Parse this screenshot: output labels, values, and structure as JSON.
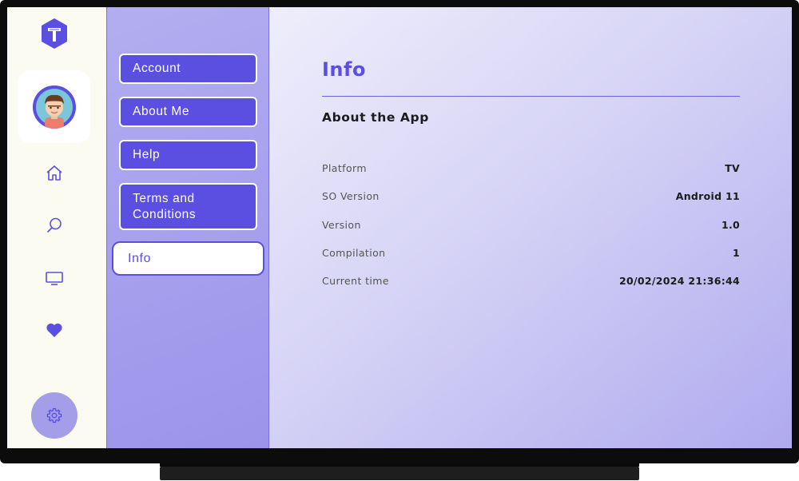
{
  "menu": {
    "items": [
      {
        "label": "Account"
      },
      {
        "label": "About Me"
      },
      {
        "label": "Help"
      },
      {
        "label": "Terms and Conditions"
      },
      {
        "label": "Info",
        "active": true
      }
    ]
  },
  "rail": {
    "icons": [
      "logo-icon",
      "avatar",
      "home-icon",
      "search-icon",
      "tv-icon",
      "heart-icon",
      "gear-icon"
    ]
  },
  "info": {
    "title": "Info",
    "subtitle": "About the App",
    "rows": [
      {
        "key": "Platform",
        "value": "TV"
      },
      {
        "key": "SO Version",
        "value": "Android 11"
      },
      {
        "key": "Version",
        "value": "1.0"
      },
      {
        "key": "Compilation",
        "value": "1"
      },
      {
        "key": "Current time",
        "value": "20/02/2024 21:36:44"
      }
    ]
  },
  "colors": {
    "accent": "#5b4fe2",
    "menu_bg": "#a49ee9",
    "rail_bg": "#fbfbf2",
    "settings_bg": "#a49ee9"
  }
}
